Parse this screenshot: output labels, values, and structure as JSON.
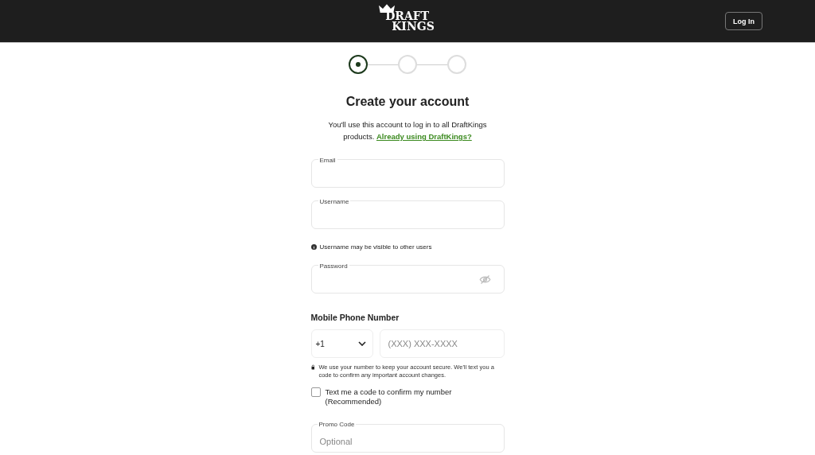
{
  "header": {
    "logo_lines": [
      "DRAFT",
      "KINGS"
    ],
    "login_button": "Log In"
  },
  "steps": [
    {
      "selected": true
    },
    {
      "selected": false
    },
    {
      "selected": false
    }
  ],
  "title": "Create your account",
  "intro": {
    "text": "You'll use this account to log in to all DraftKings products.",
    "link": "Already using DraftKings?"
  },
  "fields": [
    {
      "kind": "text",
      "label": "Email"
    },
    {
      "kind": "text",
      "label": "Username",
      "hint": "Username may be visible to other users"
    },
    {
      "kind": "password",
      "label": "Password"
    }
  ],
  "phone": {
    "heading": "Mobile Phone Number",
    "country_code": "+1",
    "placeholder": "(XXX) XXX-XXXX",
    "note": "We use your number to keep your account secure. We'll text you a code to confirm any important account changes."
  },
  "text_code": {
    "label": "Text me a code to confirm my number (Recommended)",
    "checked": false
  },
  "promo": {
    "label": "Promo Code",
    "placeholder": "Optional"
  }
}
